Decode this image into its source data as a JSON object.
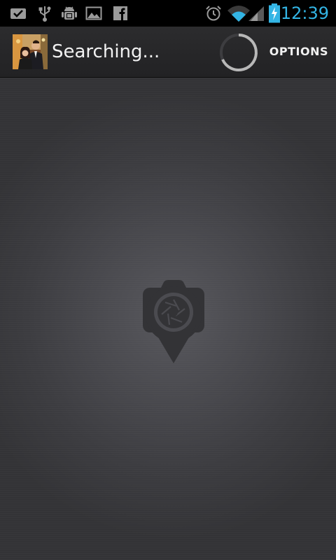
{
  "status_bar": {
    "time": "12:39",
    "notification_icons": [
      "gmail-icon",
      "usb-icon",
      "android-debug-icon",
      "image-icon",
      "facebook-icon"
    ],
    "system_icons": [
      "alarm-icon",
      "wifi-icon",
      "cell-signal-icon",
      "battery-charging-icon"
    ],
    "clock_color": "#33b5e5"
  },
  "action_bar": {
    "title": "Searching...",
    "options_label": "OPTIONS",
    "avatar_icon": "profile-photo"
  },
  "main": {
    "center_icon": "camera-location-pin-icon"
  }
}
